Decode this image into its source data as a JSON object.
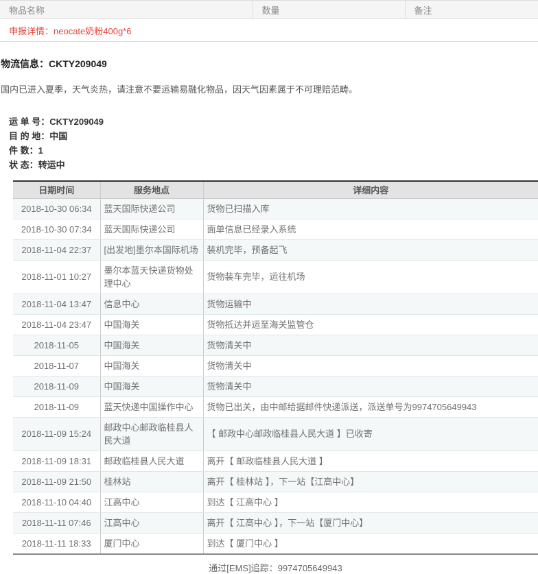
{
  "declaration": {
    "columns": [
      "物品名称",
      "数量",
      "备注"
    ],
    "detail_label": "申报详情：",
    "detail_value": "neocate奶粉400g*6",
    "detail_full": "申报详情：neocate奶粉400g*6",
    "accent_color": "#e8443a"
  },
  "logistics": {
    "heading_label": "物流信息：",
    "heading_code": "CKTY209049",
    "heading_full": "物流信息：CKTY209049",
    "notice": "国内已进入夏季，天气炎热，请注意不要运输易融化物品，因天气因素属于不可理赔范畴。",
    "meta": {
      "waybill_label": "运 单 号：",
      "waybill_value": "CKTY209049",
      "destination_label": "目 的 地：",
      "destination_value": "中国",
      "pieces_label": "件 数：",
      "pieces_value": "1",
      "status_label": "状 态：",
      "status_value": "转运中"
    }
  },
  "tracking": {
    "columns": [
      "日期时间",
      "服务地点",
      "详细内容"
    ],
    "rows": [
      {
        "date": "2018-10-30 06:34",
        "place": "蓝天国际快递公司",
        "detail": "货物已扫描入库"
      },
      {
        "date": "2018-10-30 07:34",
        "place": "蓝天国际快递公司",
        "detail": "面单信息已经录入系统"
      },
      {
        "date": "2018-11-04 22:37",
        "place": "[出发地]墨尔本国际机场",
        "detail": "装机完毕，预备起飞"
      },
      {
        "date": "2018-11-01 10:27",
        "place": "墨尔本蓝天快递货物处理中心",
        "detail": "货物装车完毕，运往机场"
      },
      {
        "date": "2018-11-04 13:47",
        "place": "信息中心",
        "detail": "货物运输中"
      },
      {
        "date": "2018-11-04 23:47",
        "place": "中国海关",
        "detail": "货物抵达并运至海关监管仓"
      },
      {
        "date": "2018-11-05",
        "place": "中国海关",
        "detail": "货物清关中"
      },
      {
        "date": "2018-11-07",
        "place": "中国海关",
        "detail": "货物清关中"
      },
      {
        "date": "2018-11-09",
        "place": "中国海关",
        "detail": "货物清关中"
      },
      {
        "date": "2018-11-09",
        "place": "蓝天快递中国操作中心",
        "detail": "货物已出关，由中邮给据邮件快递派送，派送单号为9974705649943"
      },
      {
        "date": "2018-11-09 15:24",
        "place": "邮政中心邮政临桂县人民大道",
        "detail": "【 邮政中心邮政临桂县人民大道 】已收寄"
      },
      {
        "date": "2018-11-09 18:31",
        "place": "邮政临桂县人民大道",
        "detail": "离开【 邮政临桂县人民大道 】"
      },
      {
        "date": "2018-11-09 21:50",
        "place": "桂林站",
        "detail": "离开【 桂林站 】，下一站【江高中心】"
      },
      {
        "date": "2018-11-10 04:40",
        "place": "江高中心",
        "detail": "到达【 江高中心 】"
      },
      {
        "date": "2018-11-11 07:46",
        "place": "江高中心",
        "detail": "离开【 江高中心 】，下一站【厦门中心】"
      },
      {
        "date": "2018-11-11 18:33",
        "place": "厦门中心",
        "detail": "到达【 厦门中心 】"
      }
    ],
    "footer": "通过[EMS]追踪：9974705649943"
  }
}
